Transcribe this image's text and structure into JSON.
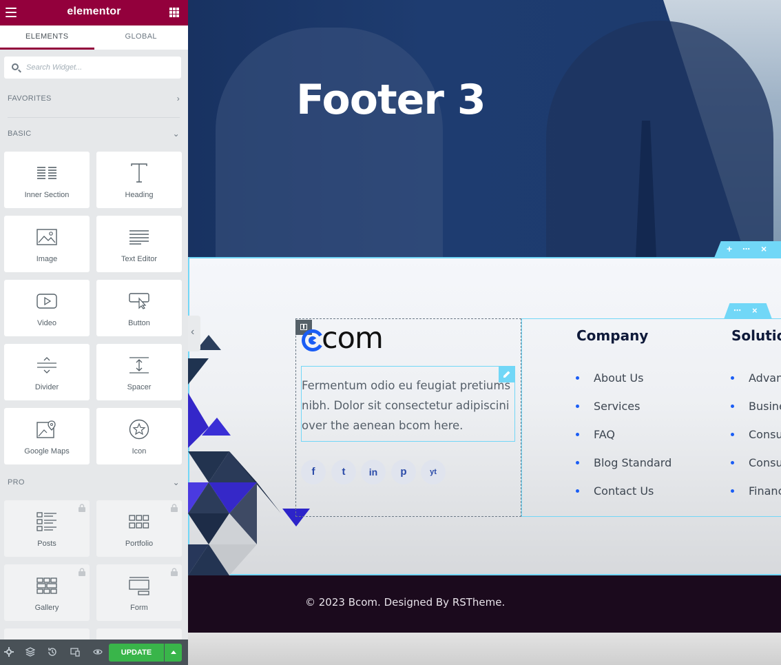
{
  "sidebar": {
    "brand": "elementor",
    "tabs": {
      "elements": "ELEMENTS",
      "global": "GLOBAL"
    },
    "search_placeholder": "Search Widget...",
    "sections": {
      "favorites": "FAVORITES",
      "basic": "BASIC",
      "pro": "PRO"
    },
    "basic_widgets": {
      "inner_section": "Inner Section",
      "heading": "Heading",
      "image": "Image",
      "text_editor": "Text Editor",
      "video": "Video",
      "button": "Button",
      "divider": "Divider",
      "spacer": "Spacer",
      "google_maps": "Google Maps",
      "icon": "Icon"
    },
    "pro_widgets": {
      "posts": "Posts",
      "portfolio": "Portfolio",
      "gallery": "Gallery",
      "form": "Form"
    },
    "update_label": "UPDATE"
  },
  "canvas": {
    "hero_title": "Footer 3",
    "logo_text": "com",
    "footer_text": "Fermentum odio eu feugiat pretiums nibh. Dolor sit consectetur adipiscini over the aenean bcom here.",
    "social": [
      "f",
      "t",
      "in",
      "p",
      "yt"
    ],
    "company": {
      "title": "Company",
      "links": [
        "About Us",
        "Services",
        "FAQ",
        "Blog Standard",
        "Contact Us"
      ]
    },
    "solutions": {
      "title": "Solutio",
      "links": [
        "Advan",
        "Busine",
        "Consu",
        "Consu",
        "Financ"
      ]
    },
    "copyright": "© 2023 Bcom. Designed By RSTheme."
  },
  "colors": {
    "brand": "#93003c",
    "accent": "#71d7f7",
    "update": "#39b54a",
    "logo_blue": "#1a5df5"
  }
}
